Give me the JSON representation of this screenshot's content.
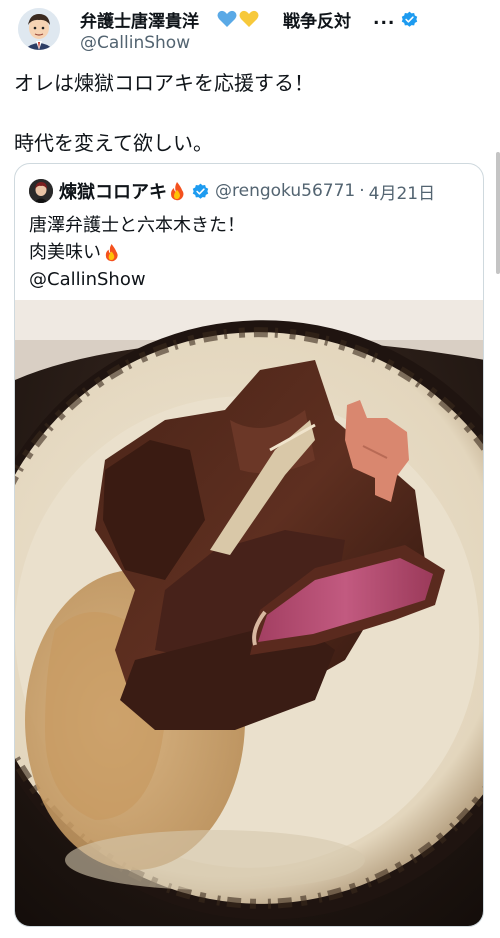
{
  "author": {
    "display_name": "弁護士唐澤貴洋",
    "slogan": "戦争反対",
    "ellipsis": "...",
    "handle": "@CallinShow",
    "hearts": [
      "blue-heart-icon",
      "yellow-heart-icon"
    ]
  },
  "tweet": {
    "line1": "オレは煉獄コロアキを応援する！",
    "line2": "時代を変えて欲しい。"
  },
  "quote": {
    "display_name": "煉獄コロアキ",
    "handle": "@rengoku56771",
    "separator": "·",
    "date": "4月21日",
    "line1": "唐澤弁護士と六本木きた！",
    "line2": "肉美味い",
    "line3": "@CallinShow"
  },
  "colors": {
    "verified": "#1d9bf0",
    "secondary_text": "#536471",
    "border": "#cfd9de"
  }
}
